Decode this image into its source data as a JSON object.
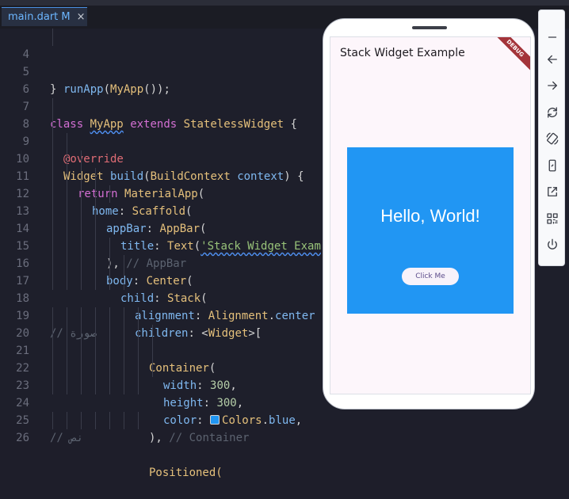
{
  "tab": {
    "label": "main.dart M",
    "close": "×"
  },
  "code_lines": [
    {
      "num": "4",
      "text": "runApp(MyApp());"
    },
    {
      "num": "5",
      "text": "}"
    },
    {
      "num": "6",
      "text": ""
    },
    {
      "num": "7",
      "text": "class MyApp extends StatelessWidget {"
    },
    {
      "num": "8",
      "text": "@override"
    },
    {
      "num": "9",
      "text": "Widget build(BuildContext context) {"
    },
    {
      "num": "10",
      "text": "return MaterialApp("
    },
    {
      "num": "11",
      "text": "home: Scaffold("
    },
    {
      "num": "12",
      "text": "appBar: AppBar("
    },
    {
      "num": "13",
      "text": "title: Text('Stack Widget Exam"
    },
    {
      "num": "14",
      "text": "), // AppBar"
    },
    {
      "num": "15",
      "text": "body: Center("
    },
    {
      "num": "16",
      "text": "child: Stack("
    },
    {
      "num": "17",
      "text": "alignment: Alignment.center"
    },
    {
      "num": "18",
      "text": "children: <Widget>["
    },
    {
      "num": "19",
      "text": "// صورة"
    },
    {
      "num": "20",
      "text": "Container("
    },
    {
      "num": "21",
      "text": "width: 300,"
    },
    {
      "num": "22",
      "text": "height: 300,"
    },
    {
      "num": "23",
      "text": "color: Colors.blue,"
    },
    {
      "num": "24",
      "text": "), // Container"
    },
    {
      "num": "25",
      "text": "// نص"
    },
    {
      "num": "26",
      "text": "Positioned("
    }
  ],
  "device": {
    "app_bar_title": "Stack Widget Example",
    "debug_banner": "DEBUG",
    "hello_text": "Hello, World!",
    "button_label": "Click Me"
  },
  "toolbar": {
    "buttons": [
      "minimize-icon",
      "back-icon",
      "forward-icon",
      "rotate-icon",
      "rotate-screen-icon",
      "phone-icon",
      "open-external-icon",
      "qr-code-icon",
      "power-icon"
    ]
  },
  "colors": {
    "accent": "#4a90e2",
    "container_blue": "#2196f3",
    "editor_bg": "#1e1f2b"
  }
}
